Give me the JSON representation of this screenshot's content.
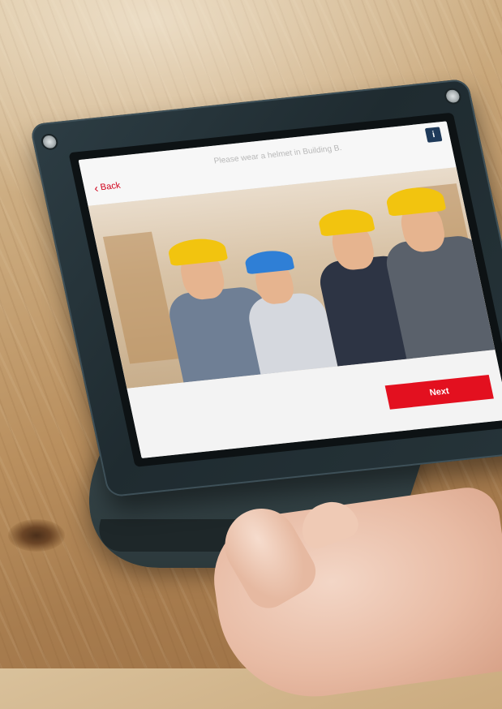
{
  "screen": {
    "header": {
      "back_label": "Back",
      "title": "Please wear a helmet in Building B."
    },
    "footer": {
      "next_label": "Next"
    },
    "photo_alt": "Workers in hard hats shaking hands"
  },
  "colors": {
    "accent_red": "#e3101f",
    "frame": "#263439",
    "info_button": "#1f3a5a"
  },
  "icons": {
    "back": "chevron-left-icon",
    "info": "info-icon"
  }
}
